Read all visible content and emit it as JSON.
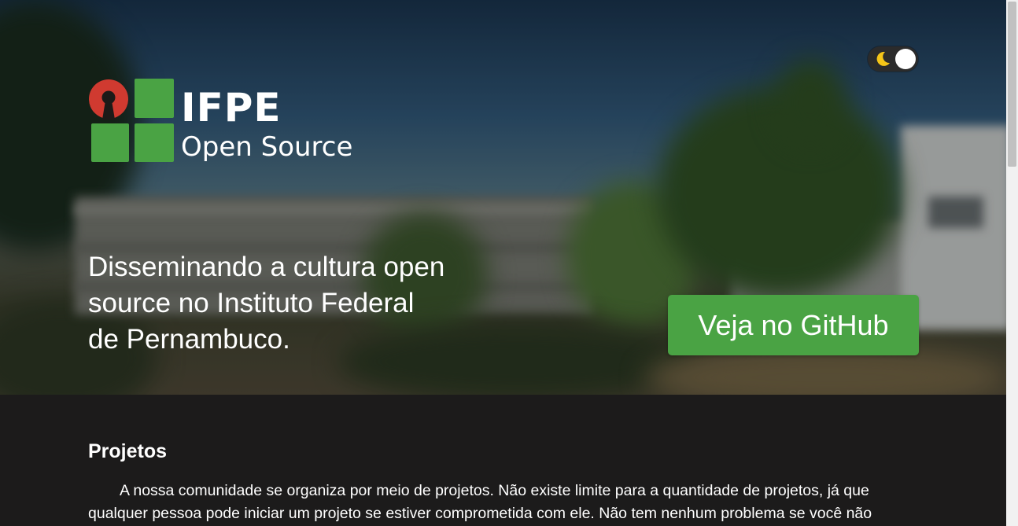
{
  "hero": {
    "logo": {
      "title": "IFPE",
      "subtitle": "Open Source"
    },
    "theme_toggle": {
      "icon": "moon-icon",
      "state": "dark"
    },
    "tagline": "Disseminando a cultura open source no Instituto Federal de Pernambuco.",
    "github_button": "Veja no GitHub"
  },
  "projects": {
    "title": "Projetos",
    "body": "A nossa comunidade se organiza por meio de projetos. Não existe limite para a quantidade de projetos, já que qualquer pessoa pode iniciar um projeto se estiver comprometida com ele. Não tem nenhum problema se você não"
  },
  "colors": {
    "accent_green": "#4aa344",
    "logo_red": "#d03a30",
    "logo_green": "#4aa344",
    "background_dark": "#1c1b1b"
  }
}
